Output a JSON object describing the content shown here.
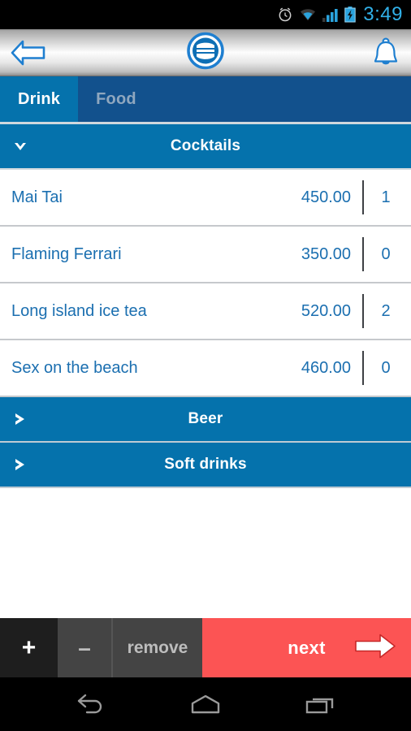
{
  "status_bar": {
    "time": "3:49",
    "icons": [
      "alarm-icon",
      "wifi-icon",
      "signal-icon",
      "battery-charging-icon"
    ],
    "time_color": "#31b0e8"
  },
  "app_bar": {
    "back_label": "back-arrow",
    "logo_label": "app-logo",
    "notification_label": "bell"
  },
  "tabs": [
    {
      "label": "Drink",
      "active": true
    },
    {
      "label": "Food",
      "active": false
    }
  ],
  "menu": {
    "groups": [
      {
        "title": "Cocktails",
        "expanded": true,
        "chevron": "chevron-down-icon",
        "items": [
          {
            "name": "Mai Tai",
            "price": "450.00",
            "qty": "1"
          },
          {
            "name": "Flaming Ferrari",
            "price": "350.00",
            "qty": "0"
          },
          {
            "name": "Long island ice tea",
            "price": "520.00",
            "qty": "2"
          },
          {
            "name": "Sex on the beach",
            "price": "460.00",
            "qty": "0"
          }
        ]
      },
      {
        "title": "Beer",
        "expanded": false,
        "chevron": "chevron-right-icon",
        "items": []
      },
      {
        "title": "Soft drinks",
        "expanded": false,
        "chevron": "chevron-right-icon",
        "items": []
      }
    ]
  },
  "action_bar": {
    "plus_label": "+",
    "minus_label": "–",
    "remove_label": "remove",
    "next_label": "next",
    "next_arrow": "arrow-right-icon"
  },
  "nav_bar": {
    "back_label": "nav-back",
    "home_label": "nav-home",
    "recents_label": "nav-recents"
  },
  "colors": {
    "accent_blue": "#0572ac",
    "tab_bar_blue": "#12518d",
    "text_blue": "#1b6fb0",
    "next_red": "#fc5454",
    "dark_button": "#1e1e1e",
    "gray_button": "#444444"
  }
}
